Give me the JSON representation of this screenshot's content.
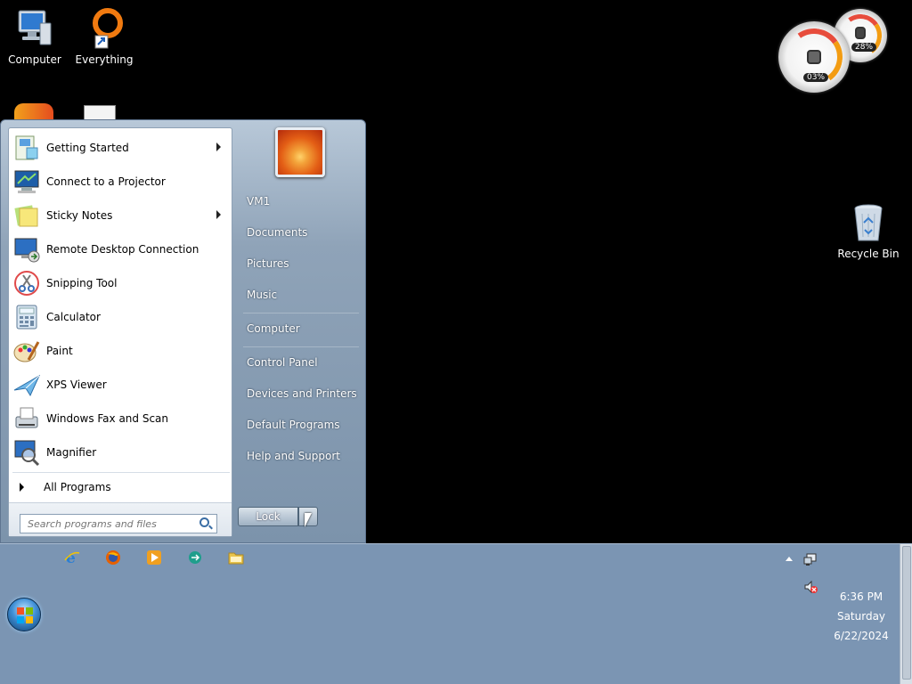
{
  "desktop": {
    "icons": [
      {
        "label": "Computer",
        "icon": "computer-icon"
      },
      {
        "label": "Everything",
        "icon": "everything-icon"
      },
      {
        "label": "Recycle Bin",
        "icon": "recycle-bin-icon"
      }
    ]
  },
  "gadget": {
    "cpu_label": "03%",
    "memory_label": "28%"
  },
  "start_menu": {
    "programs": [
      {
        "label": "Getting Started",
        "icon": "getting-started-icon",
        "has_submenu": true
      },
      {
        "label": "Connect to a Projector",
        "icon": "projector-icon",
        "has_submenu": false
      },
      {
        "label": "Sticky Notes",
        "icon": "sticky-notes-icon",
        "has_submenu": true
      },
      {
        "label": "Remote Desktop Connection",
        "icon": "remote-desktop-icon",
        "has_submenu": false
      },
      {
        "label": "Snipping Tool",
        "icon": "snipping-tool-icon",
        "has_submenu": false
      },
      {
        "label": "Calculator",
        "icon": "calculator-icon",
        "has_submenu": false
      },
      {
        "label": "Paint",
        "icon": "paint-icon",
        "has_submenu": false
      },
      {
        "label": "XPS Viewer",
        "icon": "xps-viewer-icon",
        "has_submenu": false
      },
      {
        "label": "Windows Fax and Scan",
        "icon": "fax-scan-icon",
        "has_submenu": false
      },
      {
        "label": "Magnifier",
        "icon": "magnifier-icon",
        "has_submenu": false
      }
    ],
    "all_programs_label": "All Programs",
    "search_placeholder": "Search programs and files",
    "right_items": [
      {
        "label": "VM1"
      },
      {
        "label": "Documents"
      },
      {
        "label": "Pictures"
      },
      {
        "label": "Music"
      },
      {
        "label": "Computer"
      },
      {
        "label": "Control Panel"
      },
      {
        "label": "Devices and Printers"
      },
      {
        "label": "Default Programs"
      },
      {
        "label": "Help and Support"
      }
    ],
    "lock_label": "Lock"
  },
  "taskbar": {
    "pinned": [
      {
        "icon": "internet-explorer-icon",
        "color": "#2d7fd3"
      },
      {
        "icon": "firefox-icon",
        "color": "#e66000"
      },
      {
        "icon": "media-player-icon",
        "color": "#f0a020"
      },
      {
        "icon": "remote-app-icon",
        "color": "#1f9e8c"
      },
      {
        "icon": "explorer-folder-icon",
        "color": "#e8c44a"
      }
    ],
    "clock": {
      "time": "6:36 PM",
      "day": "Saturday",
      "date": "6/22/2024"
    }
  }
}
